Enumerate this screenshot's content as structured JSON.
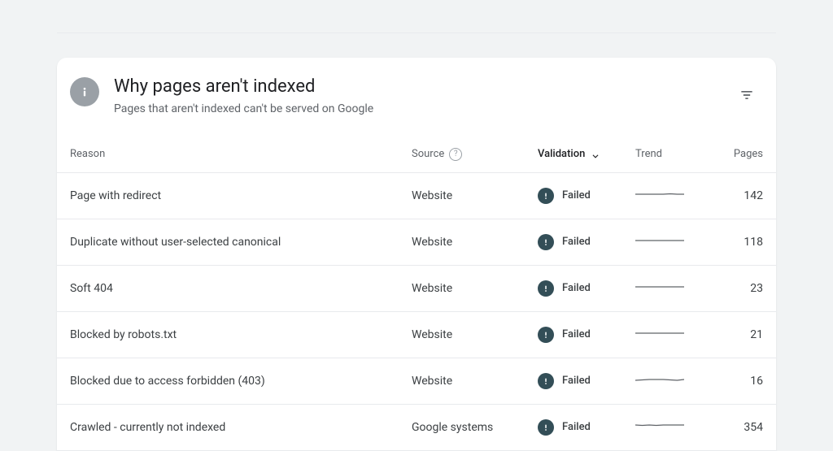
{
  "card": {
    "title": "Why pages aren't indexed",
    "subtitle": "Pages that aren't indexed can't be served on Google"
  },
  "columns": {
    "reason": "Reason",
    "source": "Source",
    "validation": "Validation",
    "trend": "Trend",
    "pages": "Pages"
  },
  "rows": [
    {
      "reason": "Page with redirect",
      "source": "Website",
      "validation": "Failed",
      "trend": [
        6,
        6,
        6,
        6,
        6,
        5.5,
        6,
        6
      ],
      "pages": "142"
    },
    {
      "reason": "Duplicate without user-selected canonical",
      "source": "Website",
      "validation": "Failed",
      "trend": [
        6,
        6,
        6,
        6,
        6,
        6,
        6,
        6
      ],
      "pages": "118"
    },
    {
      "reason": "Soft 404",
      "source": "Website",
      "validation": "Failed",
      "trend": [
        6,
        6,
        6,
        6,
        6,
        6,
        6,
        6
      ],
      "pages": "23"
    },
    {
      "reason": "Blocked by robots.txt",
      "source": "Website",
      "validation": "Failed",
      "trend": [
        6,
        6,
        6,
        6,
        6,
        6,
        6,
        6
      ],
      "pages": "21"
    },
    {
      "reason": "Blocked due to access forbidden (403)",
      "source": "Website",
      "validation": "Failed",
      "trend": [
        7,
        6.5,
        6,
        6,
        6,
        6.5,
        7,
        6
      ],
      "pages": "16"
    },
    {
      "reason": "Crawled - currently not indexed",
      "source": "Google systems",
      "validation": "Failed",
      "trend": [
        5,
        5.5,
        5,
        5.5,
        5,
        5,
        5,
        5
      ],
      "pages": "354"
    }
  ]
}
